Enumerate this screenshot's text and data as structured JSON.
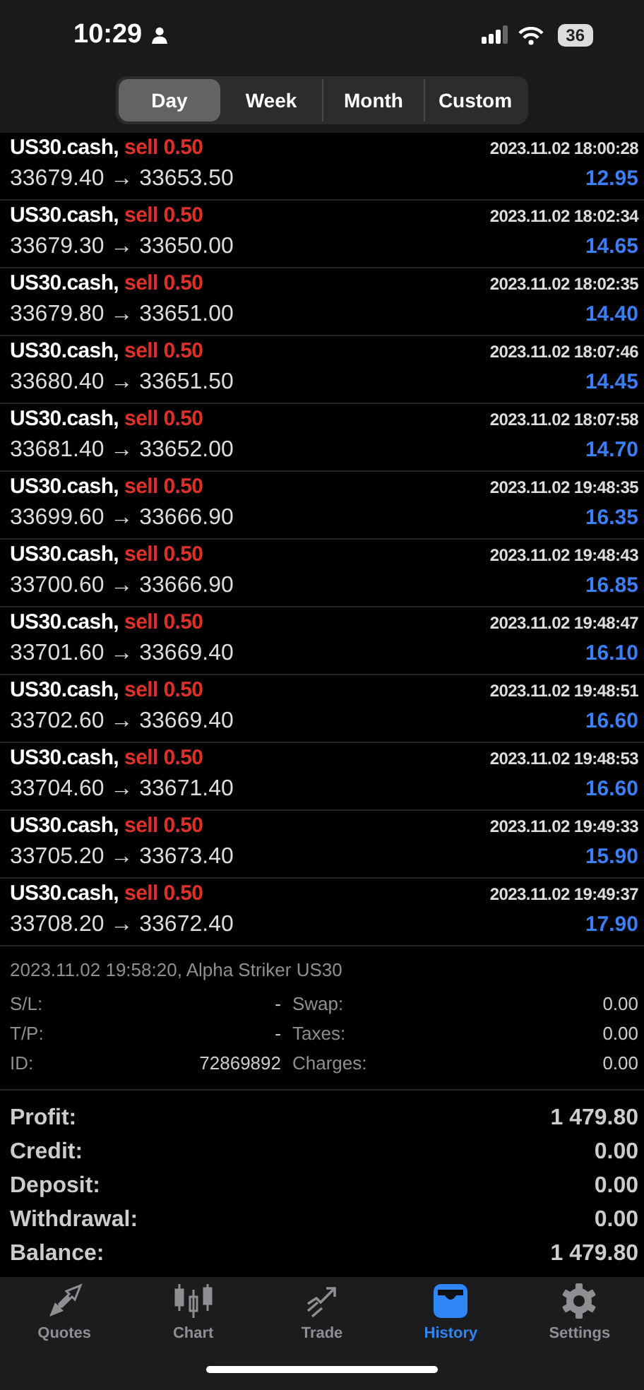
{
  "status_bar": {
    "time": "10:29",
    "battery": "36"
  },
  "tabs": [
    {
      "label": "Day",
      "selected": true
    },
    {
      "label": "Week",
      "selected": false
    },
    {
      "label": "Month",
      "selected": false
    },
    {
      "label": "Custom",
      "selected": false
    }
  ],
  "deals": [
    {
      "symbol": "US30.cash,",
      "action": "sell 0.50",
      "time": "2023.11.02 18:00:28",
      "prices": "33679.40 → 33653.50",
      "profit": "12.95"
    },
    {
      "symbol": "US30.cash,",
      "action": "sell 0.50",
      "time": "2023.11.02 18:02:34",
      "prices": "33679.30 → 33650.00",
      "profit": "14.65"
    },
    {
      "symbol": "US30.cash,",
      "action": "sell 0.50",
      "time": "2023.11.02 18:02:35",
      "prices": "33679.80 → 33651.00",
      "profit": "14.40"
    },
    {
      "symbol": "US30.cash,",
      "action": "sell 0.50",
      "time": "2023.11.02 18:07:46",
      "prices": "33680.40 → 33651.50",
      "profit": "14.45"
    },
    {
      "symbol": "US30.cash,",
      "action": "sell 0.50",
      "time": "2023.11.02 18:07:58",
      "prices": "33681.40 → 33652.00",
      "profit": "14.70"
    },
    {
      "symbol": "US30.cash,",
      "action": "sell 0.50",
      "time": "2023.11.02 19:48:35",
      "prices": "33699.60 → 33666.90",
      "profit": "16.35"
    },
    {
      "symbol": "US30.cash,",
      "action": "sell 0.50",
      "time": "2023.11.02 19:48:43",
      "prices": "33700.60 → 33666.90",
      "profit": "16.85"
    },
    {
      "symbol": "US30.cash,",
      "action": "sell 0.50",
      "time": "2023.11.02 19:48:47",
      "prices": "33701.60 → 33669.40",
      "profit": "16.10"
    },
    {
      "symbol": "US30.cash,",
      "action": "sell 0.50",
      "time": "2023.11.02 19:48:51",
      "prices": "33702.60 → 33669.40",
      "profit": "16.60"
    },
    {
      "symbol": "US30.cash,",
      "action": "sell 0.50",
      "time": "2023.11.02 19:48:53",
      "prices": "33704.60 → 33671.40",
      "profit": "16.60"
    },
    {
      "symbol": "US30.cash,",
      "action": "sell 0.50",
      "time": "2023.11.02 19:49:33",
      "prices": "33705.20 → 33673.40",
      "profit": "15.90"
    },
    {
      "symbol": "US30.cash,",
      "action": "sell 0.50",
      "time": "2023.11.02 19:49:37",
      "prices": "33708.20 → 33672.40",
      "profit": "17.90"
    }
  ],
  "details": {
    "header": "2023.11.02 19:58:20, Alpha Striker US30",
    "rows": [
      {
        "label": "S/L:",
        "value": "-",
        "label_2": "Swap:",
        "value_2": "0.00"
      },
      {
        "label": "T/P:",
        "value": "-",
        "label_2": "Taxes:",
        "value_2": "0.00"
      },
      {
        "label": "ID:",
        "value": "72869892",
        "label_2": "Charges:",
        "value_2": "0.00"
      }
    ]
  },
  "summary": [
    {
      "label": "Profit:",
      "value": "1 479.80"
    },
    {
      "label": "Credit:",
      "value": "0.00"
    },
    {
      "label": "Deposit:",
      "value": "0.00"
    },
    {
      "label": "Withdrawal:",
      "value": "0.00"
    },
    {
      "label": "Balance:",
      "value": "1 479.80"
    }
  ],
  "tab_bar": [
    {
      "label": "Quotes",
      "kind": "quotes",
      "selected": false
    },
    {
      "label": "Chart",
      "kind": "chart",
      "selected": false
    },
    {
      "label": "Trade",
      "kind": "trade",
      "selected": false
    },
    {
      "label": "History",
      "kind": "history",
      "selected": true
    },
    {
      "label": "Settings",
      "kind": "settings",
      "selected": false
    }
  ]
}
